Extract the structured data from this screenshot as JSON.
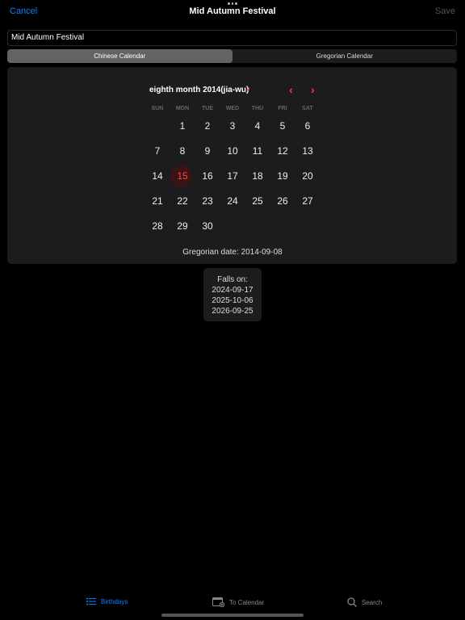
{
  "nav": {
    "cancel_label": "Cancel",
    "title": "Mid Autumn Festival",
    "save_label": "Save"
  },
  "name_field": {
    "value": "Mid Autumn Festival"
  },
  "segments": {
    "chinese": "Chinese Calendar",
    "gregorian": "Gregorian Calendar",
    "selected": "chinese"
  },
  "calendar": {
    "month_title": "eighth month 2014(jia-wu)",
    "weekdays": [
      "SUN",
      "MON",
      "TUE",
      "WED",
      "THU",
      "FRI",
      "SAT"
    ],
    "weeks": [
      [
        "",
        "1",
        "2",
        "3",
        "4",
        "5",
        "6"
      ],
      [
        "7",
        "8",
        "9",
        "10",
        "11",
        "12",
        "13"
      ],
      [
        "14",
        "15",
        "16",
        "17",
        "18",
        "19",
        "20"
      ],
      [
        "21",
        "22",
        "23",
        "24",
        "25",
        "26",
        "27"
      ],
      [
        "28",
        "29",
        "30",
        "",
        "",
        "",
        ""
      ]
    ],
    "selected_day": "15",
    "gregorian_date": "Gregorian date: 2014-09-08"
  },
  "falls_on": {
    "label": "Falls on:",
    "dates": [
      "2024-09-17",
      "2025-10-06",
      "2026-09-25"
    ]
  },
  "tabbar": {
    "birthdays": "Birthdays",
    "to_calendar": "To Calendar",
    "search": "Search"
  },
  "colors": {
    "accent_blue": "#0a84ff",
    "accent_red": "#ff3b30",
    "background": "#000000",
    "card": "#1c1c1e"
  }
}
